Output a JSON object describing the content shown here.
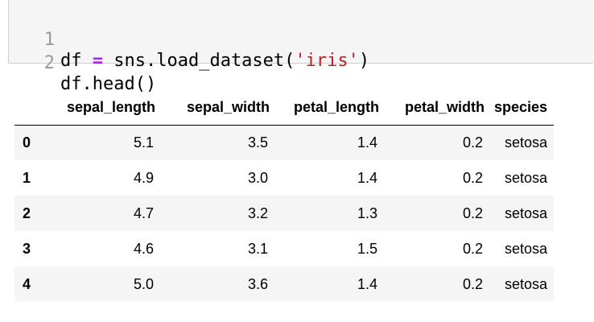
{
  "code_cell": {
    "lines": [
      {
        "number": "1",
        "tokens": {
          "a": "df ",
          "op": "=",
          "b": " sns.load_dataset(",
          "str": "'iris'",
          "c": ")"
        }
      },
      {
        "number": "2",
        "text": "df.head()"
      }
    ]
  },
  "output_table": {
    "index_header": "",
    "columns": [
      "sepal_length",
      "sepal_width",
      "petal_length",
      "petal_width",
      "species"
    ],
    "rows": [
      {
        "index": "0",
        "values": [
          "5.1",
          "3.5",
          "1.4",
          "0.2",
          "setosa"
        ]
      },
      {
        "index": "1",
        "values": [
          "4.9",
          "3.0",
          "1.4",
          "0.2",
          "setosa"
        ]
      },
      {
        "index": "2",
        "values": [
          "4.7",
          "3.2",
          "1.3",
          "0.2",
          "setosa"
        ]
      },
      {
        "index": "3",
        "values": [
          "4.6",
          "3.1",
          "1.5",
          "0.2",
          "setosa"
        ]
      },
      {
        "index": "4",
        "values": [
          "5.0",
          "3.6",
          "1.4",
          "0.2",
          "setosa"
        ]
      }
    ]
  },
  "colors": {
    "cell_background": "#f5f5f5",
    "line_number": "#999999",
    "operator": "#aa22ff",
    "string": "#ba2121",
    "row_stripe": "#f5f5f5"
  }
}
